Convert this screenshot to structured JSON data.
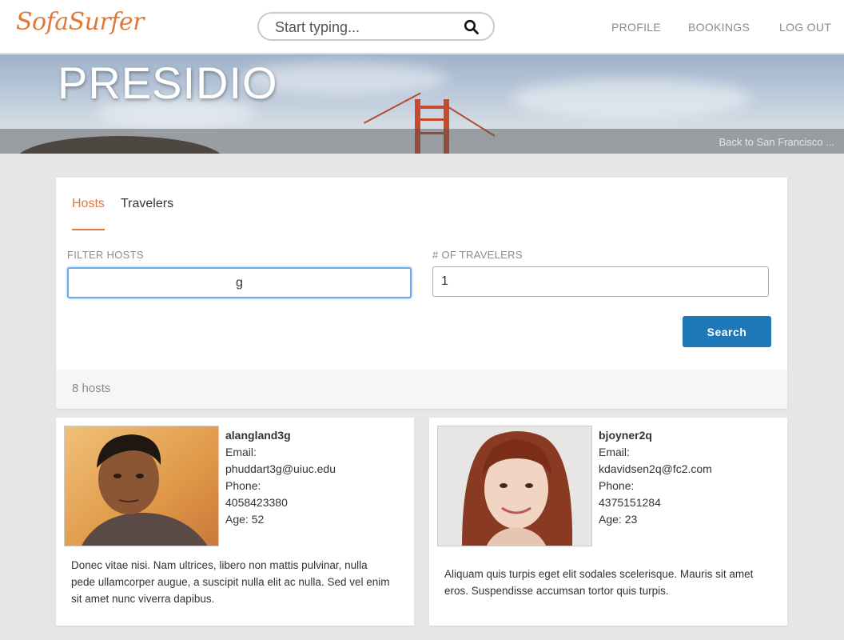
{
  "app": {
    "logo": "SofaSurfer"
  },
  "search": {
    "placeholder": "Start typing..."
  },
  "nav": {
    "profile": "PROFILE",
    "bookings": "BOOKINGS",
    "logout": "LOG OUT"
  },
  "hero": {
    "title": "PRESIDIO",
    "back_link": "Back to San Francisco ..."
  },
  "tabs": {
    "hosts": "Hosts",
    "travelers": "Travelers"
  },
  "filter": {
    "hosts_label": "FILTER HOSTS",
    "hosts_value": "g",
    "travelers_label": "# OF TRAVELERS",
    "travelers_value": "1",
    "search_button": "Search"
  },
  "results": {
    "count_text": "8 hosts"
  },
  "hosts": [
    {
      "username": "alangland3g",
      "email_label": "Email:",
      "email": "phuddart3g@uiuc.edu",
      "phone_label": "Phone:",
      "phone": "4058423380",
      "age": "Age: 52",
      "bio": "Donec vitae nisi. Nam ultrices, libero non mattis pulvinar, nulla pede ullamcorper augue, a suscipit nulla elit ac nulla. Sed vel enim sit amet nunc viverra dapibus."
    },
    {
      "username": "bjoyner2q",
      "email_label": "Email:",
      "email": "kdavidsen2q@fc2.com",
      "phone_label": "Phone:",
      "phone": "4375151284",
      "age": "Age: 23",
      "bio": "Aliquam quis turpis eget elit sodales scelerisque. Mauris sit amet eros. Suspendisse accumsan tortor quis turpis."
    }
  ],
  "colors": {
    "accent": "#e0783a",
    "button": "#1e78b8",
    "focus": "#6aa9ee"
  }
}
